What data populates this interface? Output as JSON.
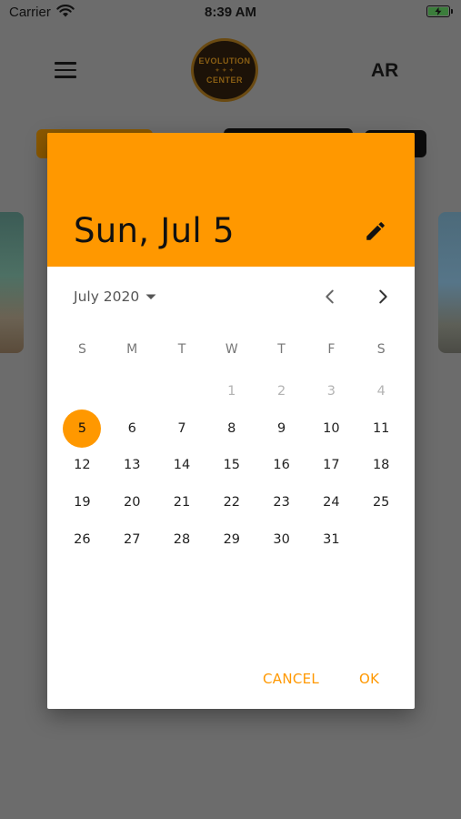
{
  "status_bar": {
    "carrier": "Carrier",
    "time": "8:39 AM"
  },
  "header": {
    "language": "AR",
    "logo_lines": [
      "EVOLUTION",
      "CENTER"
    ]
  },
  "date_picker": {
    "selected_date": "Sun, Jul 5",
    "month_label": "July 2020",
    "weekdays": [
      "S",
      "M",
      "T",
      "W",
      "T",
      "F",
      "S"
    ],
    "days": [
      {
        "label": "",
        "state": "empty"
      },
      {
        "label": "",
        "state": "empty"
      },
      {
        "label": "",
        "state": "empty"
      },
      {
        "label": "1",
        "state": "disabled"
      },
      {
        "label": "2",
        "state": "disabled"
      },
      {
        "label": "3",
        "state": "disabled"
      },
      {
        "label": "4",
        "state": "disabled"
      },
      {
        "label": "5",
        "state": "selected"
      },
      {
        "label": "6",
        "state": "normal"
      },
      {
        "label": "7",
        "state": "normal"
      },
      {
        "label": "8",
        "state": "normal"
      },
      {
        "label": "9",
        "state": "normal"
      },
      {
        "label": "10",
        "state": "normal"
      },
      {
        "label": "11",
        "state": "normal"
      },
      {
        "label": "12",
        "state": "normal"
      },
      {
        "label": "13",
        "state": "normal"
      },
      {
        "label": "14",
        "state": "normal"
      },
      {
        "label": "15",
        "state": "normal"
      },
      {
        "label": "16",
        "state": "normal"
      },
      {
        "label": "17",
        "state": "normal"
      },
      {
        "label": "18",
        "state": "normal"
      },
      {
        "label": "19",
        "state": "normal"
      },
      {
        "label": "20",
        "state": "normal"
      },
      {
        "label": "21",
        "state": "normal"
      },
      {
        "label": "22",
        "state": "normal"
      },
      {
        "label": "23",
        "state": "normal"
      },
      {
        "label": "24",
        "state": "normal"
      },
      {
        "label": "25",
        "state": "normal"
      },
      {
        "label": "26",
        "state": "normal"
      },
      {
        "label": "27",
        "state": "normal"
      },
      {
        "label": "28",
        "state": "normal"
      },
      {
        "label": "29",
        "state": "normal"
      },
      {
        "label": "30",
        "state": "normal"
      },
      {
        "label": "31",
        "state": "normal"
      }
    ],
    "cancel_label": "CANCEL",
    "ok_label": "OK",
    "accent_color": "#ff9800"
  },
  "icons": {
    "wifi": "wifi-icon",
    "battery": "battery-icon",
    "menu": "menu-icon",
    "edit": "pencil-icon",
    "dropdown": "caret-down-icon",
    "prev": "chevron-left-icon",
    "next": "chevron-right-icon"
  }
}
